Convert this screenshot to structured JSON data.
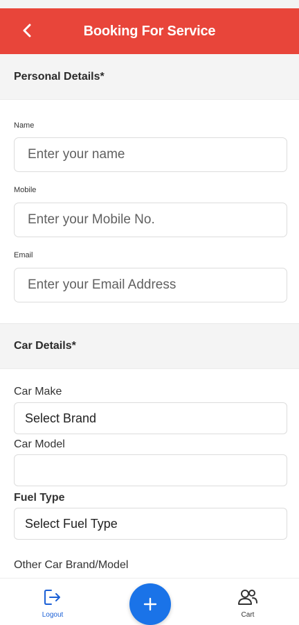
{
  "header": {
    "title": "Booking For Service"
  },
  "personal": {
    "heading": "Personal Details*",
    "name_label": "Name",
    "name_placeholder": "Enter your name",
    "mobile_label": "Mobile",
    "mobile_placeholder": "Enter your Mobile No.",
    "email_label": "Email",
    "email_placeholder": "Enter your Email Address"
  },
  "car": {
    "heading": "Car Details*",
    "make_label": "Car Make",
    "make_value": "Select Brand",
    "model_label": "Car Model",
    "model_value": "",
    "fuel_label": "Fuel Type",
    "fuel_value": "Select Fuel Type",
    "other_label": "Other Car Brand/Model"
  },
  "nav": {
    "logout": "Logout",
    "cart": "Cart",
    "fab_symbol": "+"
  },
  "colors": {
    "header": "#e8453a",
    "accent_blue": "#1a73e8"
  },
  "icons": [
    "back-chevron-icon",
    "logout-icon",
    "plus-icon",
    "users-icon"
  ]
}
